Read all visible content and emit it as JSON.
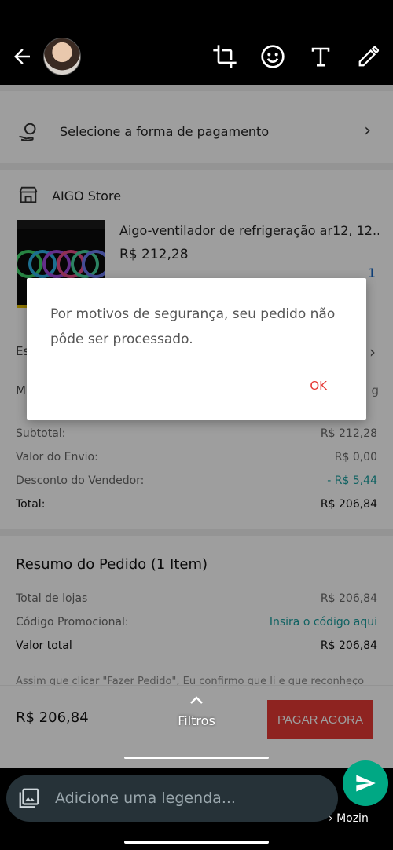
{
  "editor": {
    "back_icon": "arrow-left-icon",
    "tools": [
      "crop-rotate-icon",
      "emoji-icon",
      "text-icon",
      "pencil-icon"
    ]
  },
  "checkout": {
    "payment_label": "Selecione a forma de pagamento",
    "store_name": "AIGO Store",
    "product_title": "Aigo-ventilador de refrigeração ar12, 12...",
    "product_price": "R$ 212,28",
    "quantity": "1",
    "partial_left_1": "Es",
    "partial_left_2": "M",
    "partial_right_2": "g",
    "totals": [
      {
        "label": "Subtotal:",
        "value": "R$ 212,28"
      },
      {
        "label": "Valor do Envio:",
        "value": "R$ 0,00"
      },
      {
        "label": "Desconto do Vendedor:",
        "value": "- R$ 5,44"
      },
      {
        "label": "Total:",
        "value": "R$ 206,84"
      }
    ],
    "summary_title": "Resumo do Pedido (1 Item)",
    "summary": [
      {
        "label": "Total de lojas",
        "value": "R$ 206,84"
      },
      {
        "label": "Código Promocional:",
        "value": "Insira o código aqui"
      },
      {
        "label": "Valor total",
        "value": "R$ 206,84"
      }
    ],
    "notice": "Assim que clicar \"Fazer Pedido\", Eu confirmo que li e que reconheço",
    "bottom_total": "R$ 206,84",
    "pay_button": "PAGAR AGORA"
  },
  "dialog": {
    "message": "Por motivos de segurança, seu pedido não pôde ser processado.",
    "ok": "OK"
  },
  "filters": {
    "label": "Filtros"
  },
  "caption": {
    "placeholder": "Adicione uma legenda...",
    "recipient": "Mozin"
  },
  "colors": {
    "accent_red": "#e53935",
    "teal_link": "#1a9e9e",
    "send_green": "#00a884"
  }
}
